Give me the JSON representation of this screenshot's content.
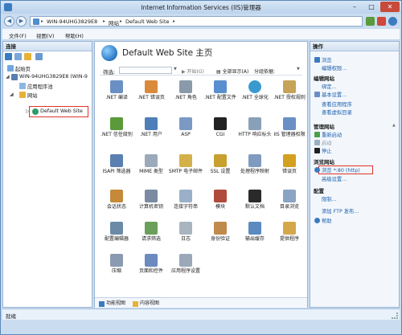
{
  "window": {
    "title": "Internet Information Services (IIS)管理器",
    "minimize_glyph": "–",
    "maximize_glyph": "□",
    "close_glyph": "✕"
  },
  "address": {
    "breadcrumbs": [
      "WIN-94UHG3829E8",
      "网站",
      "Default Web Site"
    ],
    "separator": "▸",
    "back_glyph": "◀",
    "forward_glyph": "▶"
  },
  "menu": [
    "文件(F)",
    "视图(V)",
    "帮助(H)"
  ],
  "connections": {
    "header": "连接",
    "tree": [
      {
        "label": "起始页",
        "icon": "start-page-icon"
      },
      {
        "label": "WIN-94UHG3829E8 (WIN-9",
        "icon": "server-icon",
        "expander": "◢"
      },
      {
        "label": "应用程序池",
        "icon": "app-pool-icon"
      },
      {
        "label": "网站",
        "icon": "sites-folder-icon",
        "expander": "◢"
      },
      {
        "label": "Default Web Site",
        "icon": "globe-icon",
        "expander": "▷"
      }
    ]
  },
  "center": {
    "title": "Default Web Site 主页",
    "filter": {
      "label": "筛选:",
      "arrow": "▼",
      "go_label": "▶ 开始(G)",
      "show_all_label": "▤ 全部显示(A)",
      "group_label": "分组依据:",
      "group_arrow": "▼"
    },
    "features": [
      [
        ".NET 编译",
        ".NET 错误页",
        ".NET 角色",
        ".NET 配置文件",
        ".NET 全球化",
        ".NET 授权规则"
      ],
      [
        ".NET 信任级别",
        ".NET 用户",
        "ASP",
        "CGI",
        "HTTP 响应标头",
        "IIS 管理器权限"
      ],
      [
        "ISAPI 筛选器",
        "MIME 类型",
        "SMTP 电子邮件",
        "SSL 设置",
        "处理程序映射",
        "错误页"
      ],
      [
        "会话状态",
        "计算机密钥",
        "连接字符串",
        "模块",
        "默认文档",
        "目录浏览"
      ],
      [
        "配置编辑器",
        "请求筛选",
        "日志",
        "身份验证",
        "输出缓存",
        "提供程序"
      ],
      [
        "压缩",
        "页面和控件",
        "应用程序设置"
      ]
    ],
    "tabs": [
      "功能视图",
      "内容视图"
    ]
  },
  "actions": {
    "header": "操作",
    "groups": [
      {
        "title": "",
        "links": [
          "浏览",
          "编辑权限..."
        ]
      },
      {
        "title": "编辑网站",
        "links": [
          "绑定...",
          "基本设置...",
          "查看应用程序",
          "查看虚拟目录"
        ]
      },
      {
        "title": "管理网站",
        "links": [
          "重新启动",
          "启动",
          "停止"
        ]
      },
      {
        "title": "浏览网站",
        "links": [
          "浏览 *:80 (http)",
          "高级设置..."
        ]
      },
      {
        "title": "配置",
        "links": [
          "限制...",
          "添加 FTP 发布..."
        ]
      },
      {
        "title": "",
        "links": [
          "帮助"
        ]
      }
    ],
    "collapse_glyph": "▲"
  },
  "status": {
    "text": "就绪"
  },
  "colors": {
    "accent": "#1b5fae",
    "highlight_box": "#e0332a",
    "titlebar": "#bcd3ec"
  }
}
